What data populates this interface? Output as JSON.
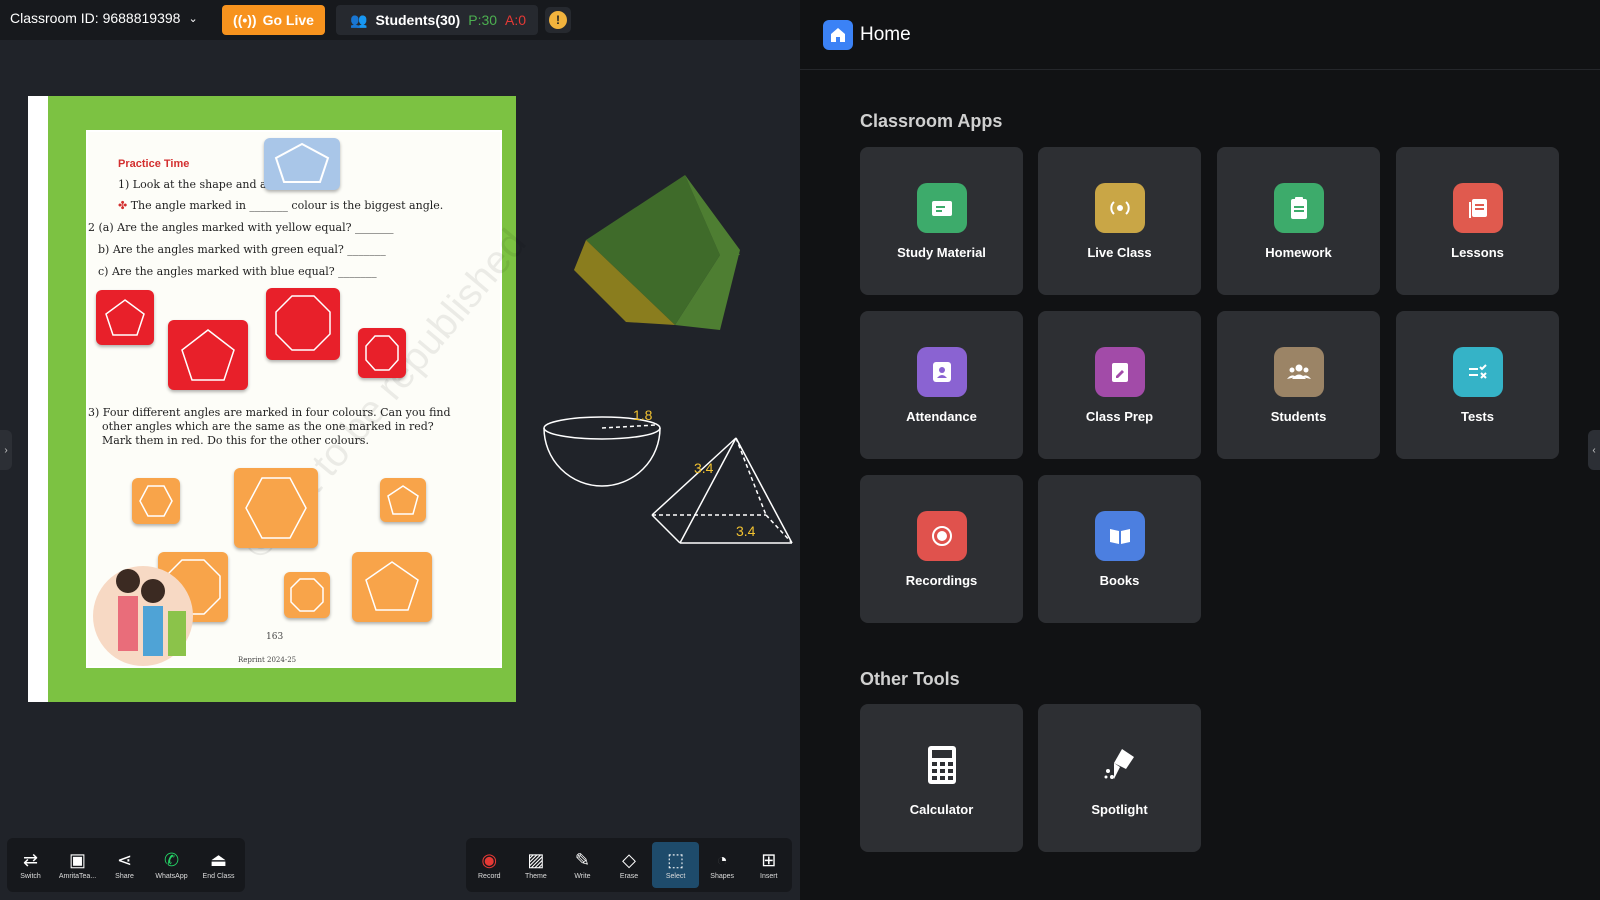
{
  "header": {
    "classroom_id": "Classroom ID: 9688819398",
    "go_live": "Go Live",
    "students_label": "Students(30)",
    "present": "P:30",
    "absent": "A:0",
    "alert_symbol": "!"
  },
  "worksheet": {
    "title": "Practice Time",
    "q1": "1) Look at the shape and answer.",
    "q1_bullet": "The angle marked in _______ colour is the biggest angle.",
    "q2a": "2 (a)  Are the angles marked with yellow equal? _______",
    "q2b": "b)  Are the angles marked with green equal? _______",
    "q2c": "c)  Are the angles marked with blue equal? _______",
    "q3_line1": "3) Four different angles are marked in four colours. Can you find",
    "q3_line2": "other angles which are the same as the one marked in red?",
    "q3_line3": "Mark them in red. Do this for the other colours.",
    "page_number": "163",
    "footer": "Reprint 2024-25",
    "watermark": "© not to be republished"
  },
  "whiteboard": {
    "bowl_label": "1.8",
    "pyramid_label_side": "3.4",
    "pyramid_label_base": "3.4"
  },
  "toolbar_left": [
    {
      "label": "Switch",
      "icon": "⇄"
    },
    {
      "label": "AmritaTea...",
      "icon": "▣"
    },
    {
      "label": "Share",
      "icon": "⋖"
    },
    {
      "label": "WhatsApp",
      "icon": "✆"
    },
    {
      "label": "End Class",
      "icon": "⏏"
    }
  ],
  "toolbar_right": [
    {
      "label": "Record",
      "icon": "◉"
    },
    {
      "label": "Theme",
      "icon": "▨"
    },
    {
      "label": "Write",
      "icon": "✎"
    },
    {
      "label": "Erase",
      "icon": "◇"
    },
    {
      "label": "Select",
      "icon": "⬚"
    },
    {
      "label": "Shapes",
      "icon": "◔"
    },
    {
      "label": "Insert",
      "icon": "⊞"
    }
  ],
  "home": {
    "title": "Home",
    "classroom_apps_title": "Classroom Apps",
    "other_tools_title": "Other Tools",
    "apps": [
      {
        "label": "Study Material",
        "color": "#3dab6b",
        "icon": "folder-icon"
      },
      {
        "label": "Live Class",
        "color": "#c9a646",
        "icon": "broadcast-icon"
      },
      {
        "label": "Homework",
        "color": "#3dab6b",
        "icon": "clipboard-icon"
      },
      {
        "label": "Lessons",
        "color": "#e05a4e",
        "icon": "book-stack-icon"
      },
      {
        "label": "Attendance",
        "color": "#8a63d2",
        "icon": "attendance-icon"
      },
      {
        "label": "Class Prep",
        "color": "#a24ba8",
        "icon": "edit-note-icon"
      },
      {
        "label": "Students",
        "color": "#9b8466",
        "icon": "group-icon"
      },
      {
        "label": "Tests",
        "color": "#35b3c7",
        "icon": "test-icon"
      },
      {
        "label": "Recordings",
        "color": "#e0524d",
        "icon": "record-icon"
      },
      {
        "label": "Books",
        "color": "#4c7fe0",
        "icon": "open-book-icon"
      }
    ],
    "tools": [
      {
        "label": "Calculator",
        "icon": "calculator-icon"
      },
      {
        "label": "Spotlight",
        "icon": "spotlight-icon"
      }
    ]
  }
}
